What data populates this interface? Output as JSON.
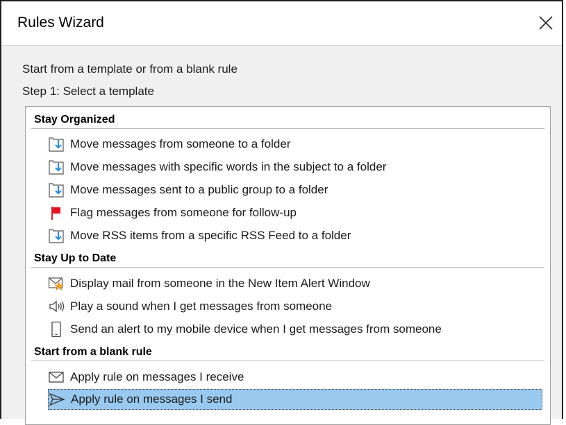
{
  "window": {
    "title": "Rules Wizard",
    "close_icon": "close-icon"
  },
  "prompt": "Start from a template or from a blank rule",
  "step": "Step 1: Select a template",
  "groups": [
    {
      "header": "Stay Organized",
      "items": [
        {
          "label": "Move messages from someone to a folder",
          "icon": "move-to-folder-icon"
        },
        {
          "label": "Move messages with specific words in the subject to a folder",
          "icon": "move-to-folder-icon"
        },
        {
          "label": "Move messages sent to a public group to a folder",
          "icon": "move-to-folder-icon"
        },
        {
          "label": "Flag messages from someone for follow-up",
          "icon": "flag-icon"
        },
        {
          "label": "Move RSS items from a specific RSS Feed to a folder",
          "icon": "move-to-folder-icon"
        }
      ]
    },
    {
      "header": "Stay Up to Date",
      "items": [
        {
          "label": "Display mail from someone in the New Item Alert Window",
          "icon": "new-item-alert-icon"
        },
        {
          "label": "Play a sound when I get messages from someone",
          "icon": "speaker-icon"
        },
        {
          "label": "Send an alert to my mobile device when I get messages from someone",
          "icon": "mobile-device-icon"
        }
      ]
    },
    {
      "header": "Start from a blank rule",
      "items": [
        {
          "label": "Apply rule on messages I receive",
          "icon": "envelope-icon"
        },
        {
          "label": "Apply rule on messages I send",
          "icon": "send-icon",
          "selected": true
        }
      ]
    }
  ],
  "colors": {
    "selection": "#99c9ef",
    "flag": "#e81123",
    "folder_arrow": "#1e88e5",
    "alert_star": "#f7a21b"
  }
}
